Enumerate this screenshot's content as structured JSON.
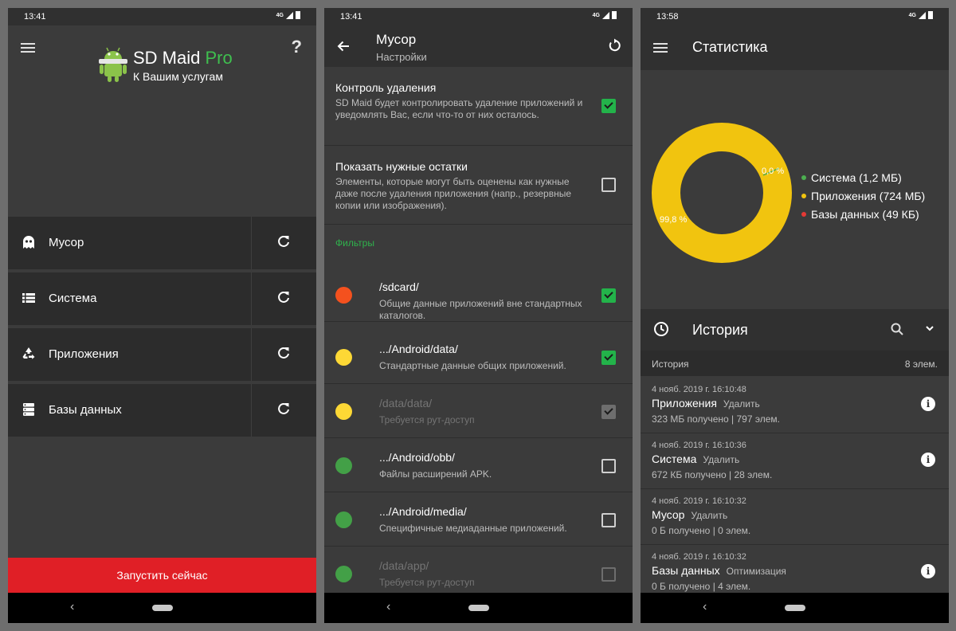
{
  "screen1": {
    "status_time": "13:41",
    "network": "4G",
    "app_title": "SD Maid",
    "app_title_suffix": "Pro",
    "app_subtitle": "К Вашим услугам",
    "help_glyph": "?",
    "tools": [
      {
        "label": "Мусор",
        "icon": "ghost-icon"
      },
      {
        "label": "Система",
        "icon": "list-icon"
      },
      {
        "label": "Приложения",
        "icon": "recycle-icon"
      },
      {
        "label": "Базы данных",
        "icon": "database-icon"
      }
    ],
    "run_button": "Запустить сейчас"
  },
  "screen2": {
    "status_time": "13:41",
    "network": "4G",
    "title": "Мусор",
    "subtitle": "Настройки",
    "settings": [
      {
        "title": "Контроль удаления",
        "desc": "SD Maid будет контролировать удаление приложений и уведомлять Вас, если что-то от них осталось.",
        "checked": true
      },
      {
        "title": "Показать нужные остатки",
        "desc": "Элементы, которые могут быть оценены как нужные даже после удаления приложения (напр., резервные копии или изображения).",
        "checked": false
      }
    ],
    "filters_header": "Фильтры",
    "filters": [
      {
        "path": "/sdcard/",
        "desc": "Общие данные приложений вне стандартных каталогов.",
        "color": "#f4511e",
        "checked": true,
        "disabled": false
      },
      {
        "path": ".../Android/data/",
        "desc": "Стандартные данные общих приложений.",
        "color": "#fdd835",
        "checked": true,
        "disabled": false
      },
      {
        "path": "/data/data/",
        "desc": "Требуется рут-доступ",
        "color": "#fdd835",
        "checked": true,
        "disabled": true
      },
      {
        "path": ".../Android/obb/",
        "desc": "Файлы расширений APK.",
        "color": "#43a047",
        "checked": false,
        "disabled": false
      },
      {
        "path": ".../Android/media/",
        "desc": "Специфичные медиаданные приложений.",
        "color": "#43a047",
        "checked": false,
        "disabled": false
      },
      {
        "path": "/data/app/",
        "desc": "Требуется рут-доступ",
        "color": "#43a047",
        "checked": false,
        "disabled": true
      }
    ]
  },
  "screen3": {
    "status_time": "13:58",
    "network": "4G",
    "title": "Статистика",
    "donut": {
      "label_small": "0,0 %",
      "label_big": "99,8 %",
      "slices": [
        {
          "name": "Система",
          "value": 0.2,
          "color": "#4caf50"
        },
        {
          "name": "Приложения",
          "value": 99.8,
          "color": "#f1c40f"
        },
        {
          "name": "Базы данных",
          "value": 0.0,
          "color": "#e53935"
        }
      ]
    },
    "legend": [
      {
        "label": "Система (1,2 МБ)",
        "color": "#4caf50"
      },
      {
        "label": "Приложения (724 МБ)",
        "color": "#f1c40f"
      },
      {
        "label": "Базы данных (49 КБ)",
        "color": "#e53935"
      }
    ],
    "history_title": "История",
    "history_sub_label": "История",
    "history_count": "8 элем.",
    "history": [
      {
        "date": "4 нояб. 2019 г. 16:10:48",
        "name": "Приложения",
        "action": "Удалить",
        "summary": "323 МБ получено | 797 элем.",
        "info": true
      },
      {
        "date": "4 нояб. 2019 г. 16:10:36",
        "name": "Система",
        "action": "Удалить",
        "summary": "672 КБ получено | 28 элем.",
        "info": true
      },
      {
        "date": "4 нояб. 2019 г. 16:10:32",
        "name": "Мусор",
        "action": "Удалить",
        "summary": "0 Б получено | 0 элем.",
        "info": false
      },
      {
        "date": "4 нояб. 2019 г. 16:10:32",
        "name": "Базы данных",
        "action": "Оптимизация",
        "summary": "0 Б получено | 4 элем.",
        "info": true
      }
    ]
  }
}
